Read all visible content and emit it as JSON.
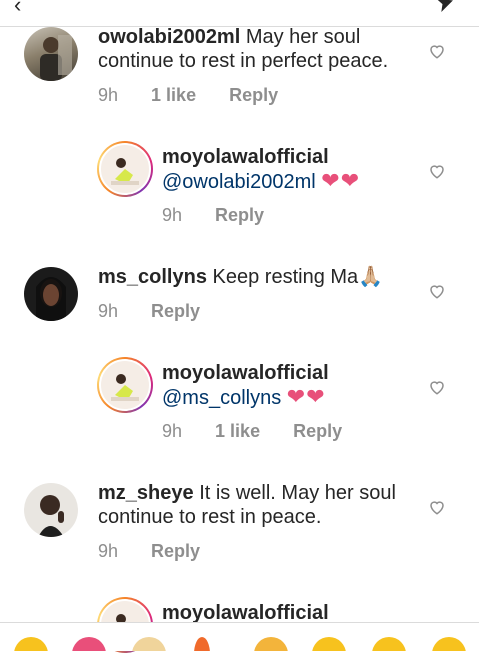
{
  "comments": [
    {
      "username": "owolabi2002ml",
      "body": "May her soul continue to rest in perfect peace.",
      "time": "9h",
      "likes": "1 like",
      "reply_label": "Reply"
    },
    {
      "username": "moyolawalofficial",
      "mention": "@owolabi2002ml",
      "emoji": "❤❤",
      "time": "9h",
      "reply_label": "Reply"
    },
    {
      "username": "ms_collyns",
      "body": "Keep resting Ma🙏🏼",
      "time": "9h",
      "reply_label": "Reply"
    },
    {
      "username": "moyolawalofficial",
      "mention": "@ms_collyns",
      "emoji": "❤❤",
      "time": "9h",
      "likes": "1 like",
      "reply_label": "Reply"
    },
    {
      "username": "mz_sheye",
      "body": "It is well.  May her soul continue to rest in peace.",
      "time": "9h",
      "reply_label": "Reply"
    },
    {
      "username": "moyolawalofficial"
    }
  ],
  "icons": {
    "back": "back-arrow-icon",
    "send": "send-icon",
    "like": "heart-outline-icon"
  },
  "colors": {
    "mention": "#003569",
    "meta": "#8e8e8e",
    "heart": "#e8507a"
  }
}
